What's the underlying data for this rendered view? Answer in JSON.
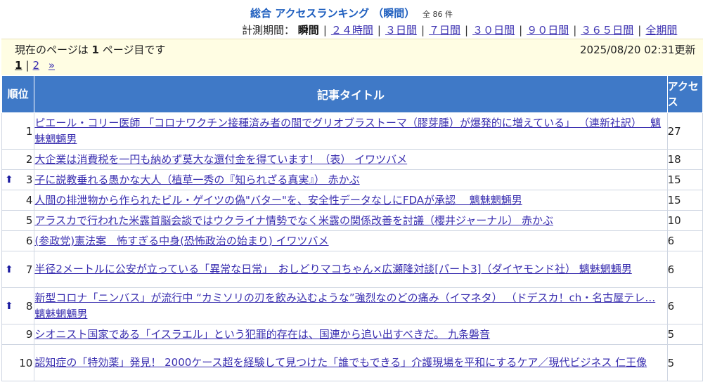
{
  "header": {
    "title": "総合 アクセスランキング （瞬間）",
    "count_text": "全 86 件",
    "period_label": "計測期間：",
    "periods": [
      {
        "label": "瞬間",
        "current": true
      },
      {
        "label": "２４時間",
        "current": false
      },
      {
        "label": "３日間",
        "current": false
      },
      {
        "label": "７日間",
        "current": false
      },
      {
        "label": "３０日間",
        "current": false
      },
      {
        "label": "９０日間",
        "current": false
      },
      {
        "label": "３６５日間",
        "current": false
      },
      {
        "label": "全期間",
        "current": false
      }
    ]
  },
  "info": {
    "page_prefix": "現在のページは",
    "page_number": "1",
    "page_suffix": "ページ目です",
    "updated": "2025/08/20 02:31更新"
  },
  "pager": {
    "current": "1",
    "next_page": "2",
    "next_arrow": "»"
  },
  "table": {
    "headers": {
      "rank": "順位",
      "title": "記事タイトル",
      "access": "アクセス"
    },
    "rows": [
      {
        "rank": "1",
        "up": false,
        "title": "ピエール・コリー医師 「コロナワクチン接種済み者の間でグリオブラストーマ（膠芽腫）が爆発的に増えている」 （連新社訳）　 魑魅魍魎男",
        "access": "27"
      },
      {
        "rank": "2",
        "up": false,
        "title": "大企業は消費税を一円も納めず莫大な還付金を得ています！（表）  イワツバメ",
        "access": "18"
      },
      {
        "rank": "3",
        "up": true,
        "title": "子に説教垂れる愚かな大人（植草一秀の『知られざる真実』） 赤かぶ",
        "access": "15"
      },
      {
        "rank": "4",
        "up": false,
        "title": "人間の排泄物から作られたビル・ゲイツの偽\"バター\"を、安全性データなしにFDAが承認　 魑魅魍魎男",
        "access": "15"
      },
      {
        "rank": "5",
        "up": false,
        "title": "アラスカで行われた米露首脳会談ではウクライナ情勢でなく米露の関係改善を討議（櫻井ジャーナル） 赤かぶ",
        "access": "10"
      },
      {
        "rank": "6",
        "up": false,
        "title": "(参政党)憲法案　怖すぎる中身(恐怖政治の始まり)  イワツバメ",
        "access": "6"
      },
      {
        "rank": "7",
        "up": true,
        "title": "半径2メートルに公安が立っている「異常な日常」　おしどりマコちゃん×広瀬隆対談[パート3]（ダイヤモンド社） 魑魅魍魎男",
        "access": "6"
      },
      {
        "rank": "8",
        "up": true,
        "title": "新型コロナ「ニンバス」が流行中 “カミソリの刃を飲み込むような”強烈なのどの痛み（イマネタ） （ドデスカ！ch・名古屋テレ… 魑魅魍魎男",
        "access": "6"
      },
      {
        "rank": "9",
        "up": false,
        "title": "シオニスト国家である「イスラエル」という犯罪的存在は、国連から追い出すべきだ。 九条磐音",
        "access": "5"
      },
      {
        "rank": "10",
        "up": false,
        "title": "認知症の「特効薬」発見！ 2000ケース超を経験して見つけた「誰でもできる」介護現場を平和にするケア／現代ビジネス 仁王像",
        "access": "5"
      }
    ]
  },
  "colors": {
    "header_blue": "#3f79c7",
    "title_blue": "#1f5fbf",
    "link": "#3a2fb0",
    "info_bg": "#fffde3",
    "up_arrow": "#1a1aa0"
  }
}
